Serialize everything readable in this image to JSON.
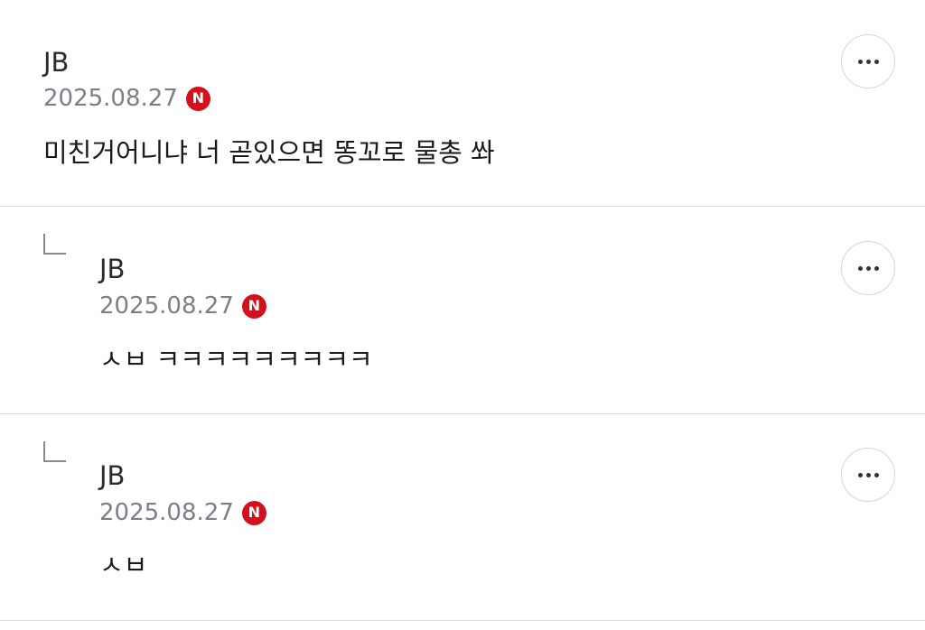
{
  "comments": [
    {
      "author": "JB",
      "date": "2025.08.27",
      "badge": "N",
      "text": "미친거어니냐 너 곧있으면 똥꼬로 물총 쏴",
      "is_reply": false,
      "more_icon": "more-horizontal-icon"
    },
    {
      "author": "JB",
      "date": "2025.08.27",
      "badge": "N",
      "text": "ㅅㅂ ㅋㅋㅋㅋㅋㅋㅋㅋㅋ",
      "is_reply": true,
      "reply_icon": "reply-arrow-icon",
      "more_icon": "more-horizontal-icon"
    },
    {
      "author": "JB",
      "date": "2025.08.27",
      "badge": "N",
      "text": "ㅅㅂ",
      "is_reply": true,
      "reply_icon": "reply-arrow-icon",
      "more_icon": "more-horizontal-icon"
    }
  ],
  "colors": {
    "badge": "#d3101c",
    "date": "#7b7f88",
    "divider": "#dcdcdc"
  }
}
